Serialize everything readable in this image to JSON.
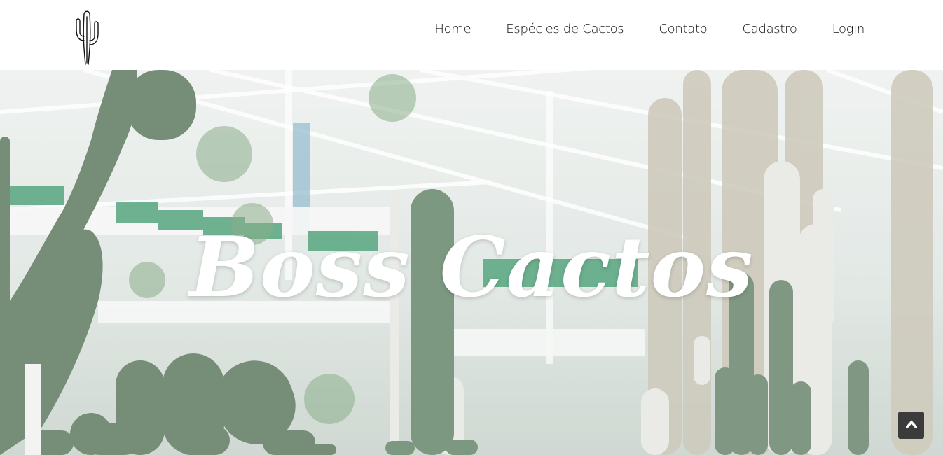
{
  "brand": {
    "logo_icon": "cactus-logo-icon"
  },
  "nav": {
    "items": [
      {
        "label": "Home"
      },
      {
        "label": "Espécies de Cactos"
      },
      {
        "label": "Contato"
      },
      {
        "label": "Cadastro"
      },
      {
        "label": "Login"
      }
    ]
  },
  "hero": {
    "title": "Boss Cactos",
    "background_image": "greenhouse-cacti-photo"
  },
  "scroll_top": {
    "icon": "caret-up-icon"
  },
  "colors": {
    "nav_background": "#ffffff",
    "nav_text": "#111111",
    "hero_title": "#ffffff",
    "scroll_button": "#3b3b3b",
    "cactus_green": "#6f8a72"
  }
}
